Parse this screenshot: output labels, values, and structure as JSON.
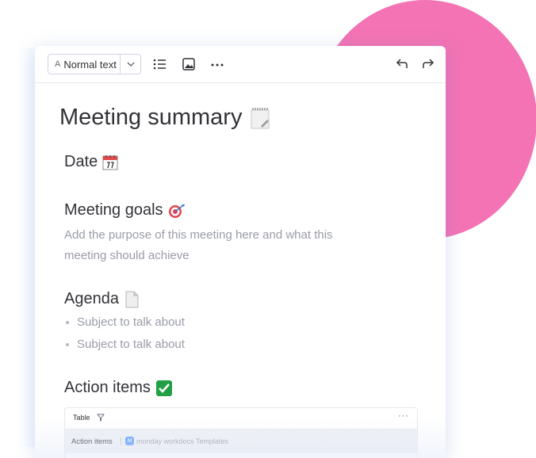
{
  "toolbar": {
    "format_prefix": "A",
    "format_label": "Normal text",
    "icons": [
      "chevron-down-icon",
      "bulleted-list-icon",
      "image-icon",
      "more-icon",
      "undo-icon",
      "redo-icon"
    ]
  },
  "doc": {
    "title": "Meeting summary",
    "date_heading": "Date",
    "goals_heading": "Meeting goals",
    "goals_text": "Add the purpose of this meeting here and what this meeting should achieve",
    "agenda_heading": "Agenda",
    "agenda_items": [
      "Subject to talk about",
      "Subject to talk about"
    ],
    "action_heading": "Action items"
  },
  "table": {
    "label": "Table",
    "more": "···",
    "row_label": "Action items",
    "badge": "M",
    "template_text": "monday workdocs Templates"
  },
  "colors": {
    "accent_blob": "#f473b4",
    "text": "#323338",
    "placeholder": "#9a9ca8",
    "brand_blue": "#579bfc",
    "check_green": "#22a045"
  }
}
